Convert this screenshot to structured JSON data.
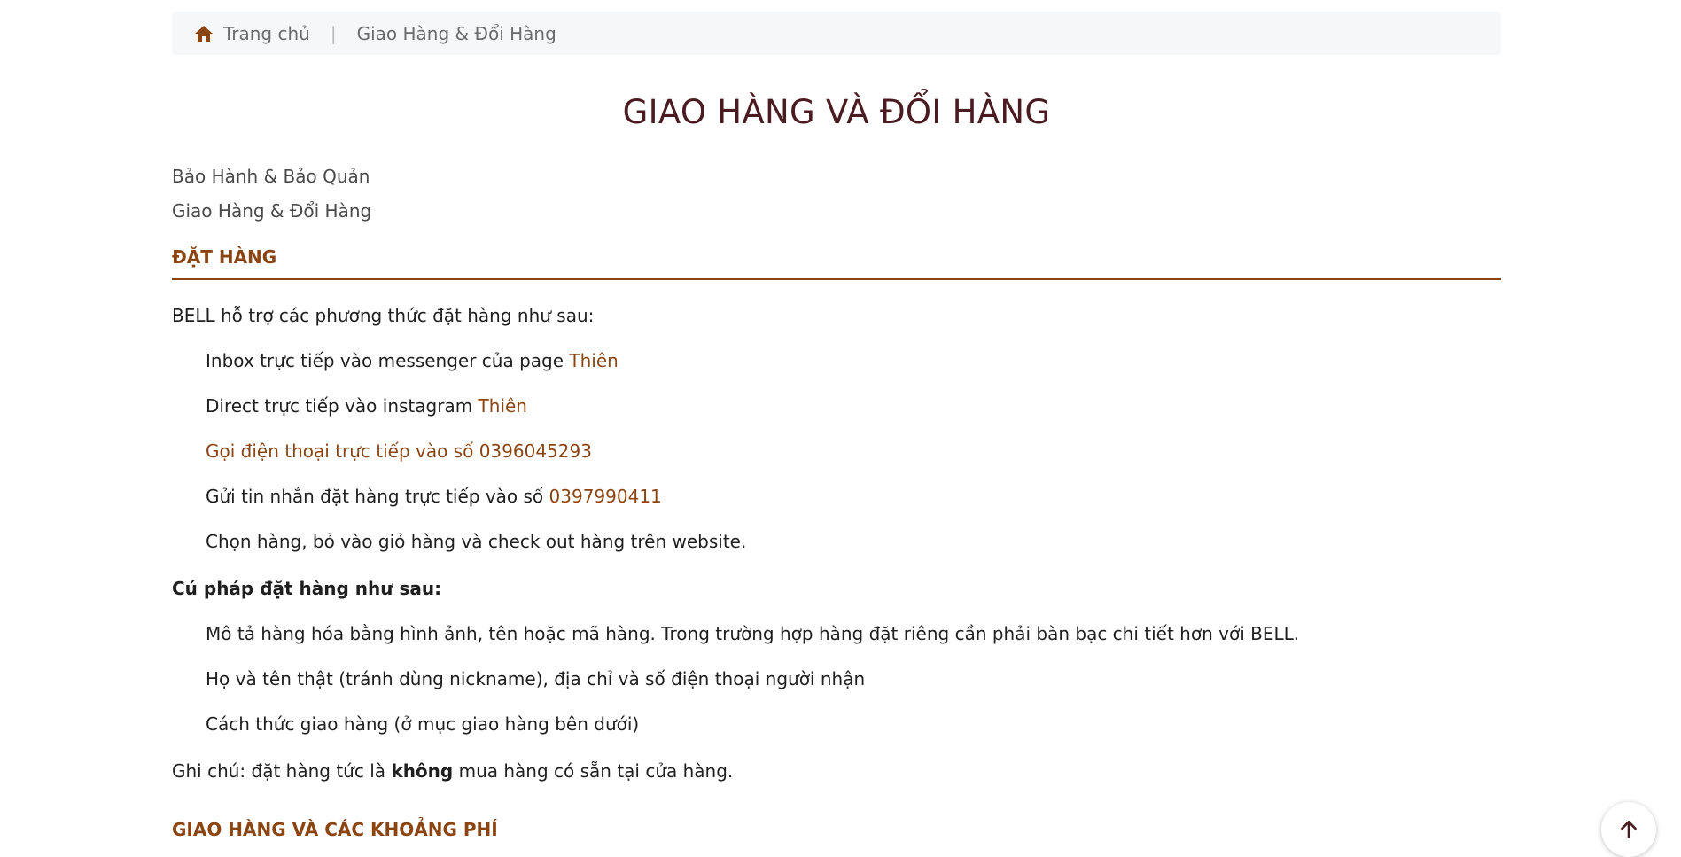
{
  "breadcrumb": {
    "home_label": "Trang chủ",
    "separator": "|",
    "current": "Giao Hàng & Đổi Hàng"
  },
  "page_title": "GIAO HÀNG VÀ ĐỔI HÀNG",
  "sub_links": [
    "Bảo Hành & Bảo Quản",
    "Giao Hàng & Đổi Hàng"
  ],
  "section_order": {
    "heading": "ĐẶT HÀNG",
    "intro": "BELL hỗ trợ các phương thức đặt hàng như sau:",
    "methods": [
      {
        "text": "Inbox trực tiếp vào messenger của page ",
        "link": "Thiên"
      },
      {
        "text": "Direct trực tiếp vào instagram ",
        "link": "Thiên"
      },
      {
        "text": "",
        "link": "Gọi điện thoại trực tiếp vào số 0396045293"
      },
      {
        "text": "Gửi tin nhắn đặt hàng trực tiếp vào số ",
        "link": "0397990411"
      },
      {
        "text": "Chọn hàng, bỏ vào giỏ hàng và check out hàng trên website.",
        "link": ""
      }
    ],
    "syntax_heading": "Cú pháp đặt hàng như sau:",
    "syntax_items": [
      "Mô tả hàng hóa bằng hình ảnh, tên hoặc mã hàng. Trong trường hợp hàng đặt riêng cần phải bàn bạc chi tiết hơn với BELL.",
      "Họ và tên thật (tránh dùng nickname), địa chỉ và số điện thoại người nhận",
      "Cách thức giao hàng (ở mục giao hàng bên dưới)"
    ],
    "note_prefix": "Ghi chú: đặt hàng tức là ",
    "note_bold": "không",
    "note_suffix": " mua hàng có sẵn tại cửa hàng."
  },
  "section_shipping": {
    "heading": "GIAO HÀNG VÀ CÁC KHOẢNG PHÍ"
  },
  "colors": {
    "accent": "#8b4513",
    "title": "#4a1c21"
  },
  "icons": {
    "home": "home-icon",
    "scroll_top": "arrow-up-icon"
  }
}
